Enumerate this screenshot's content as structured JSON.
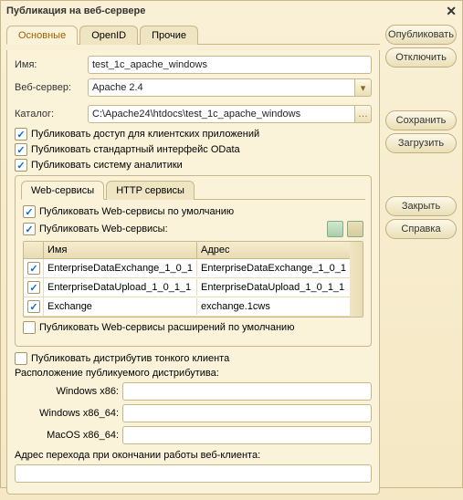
{
  "title": "Публикация на веб-сервере",
  "buttons": {
    "publish": "Опубликовать",
    "disconnect": "Отключить",
    "save": "Сохранить",
    "load": "Загрузить",
    "close": "Закрыть",
    "help": "Справка"
  },
  "tabs": {
    "main": "Основные",
    "openid": "OpenID",
    "other": "Прочие"
  },
  "labels": {
    "name": "Имя:",
    "server": "Веб-сервер:",
    "catalog": "Каталог:"
  },
  "fields": {
    "name": "test_1c_apache_windows",
    "server": "Apache 2.4",
    "catalog": "C:\\Apache24\\htdocs\\test_1c_apache_windows"
  },
  "checks": {
    "client": "Публиковать доступ для клиентских приложений",
    "odata": "Публиковать стандартный интерфейс OData",
    "analytics": "Публиковать систему аналитики"
  },
  "innerTabs": {
    "ws": "Web-сервисы",
    "http": "HTTP сервисы"
  },
  "ws": {
    "pubDefault": "Публиковать Web-сервисы по умолчанию",
    "pubWs": "Публиковать Web-сервисы:",
    "colName": "Имя",
    "colAddr": "Адрес",
    "rows": [
      {
        "name": "EnterpriseDataExchange_1_0_1",
        "addr": "EnterpriseDataExchange_1_0_1"
      },
      {
        "name": "EnterpriseDataUpload_1_0_1_1",
        "addr": "EnterpriseDataUpload_1_0_1_1"
      },
      {
        "name": "Exchange",
        "addr": "exchange.1cws"
      }
    ],
    "pubExt": "Публиковать Web-сервисы расширений по умолчанию"
  },
  "thin": {
    "check": "Публиковать дистрибутив тонкого клиента",
    "loc": "Расположение публикуемого дистрибутива:",
    "winX86": "Windows x86:",
    "winX8664": "Windows x86_64:",
    "mac": "MacOS x86_64:"
  },
  "redirect": "Адрес перехода при окончании работы веб-клиента:"
}
